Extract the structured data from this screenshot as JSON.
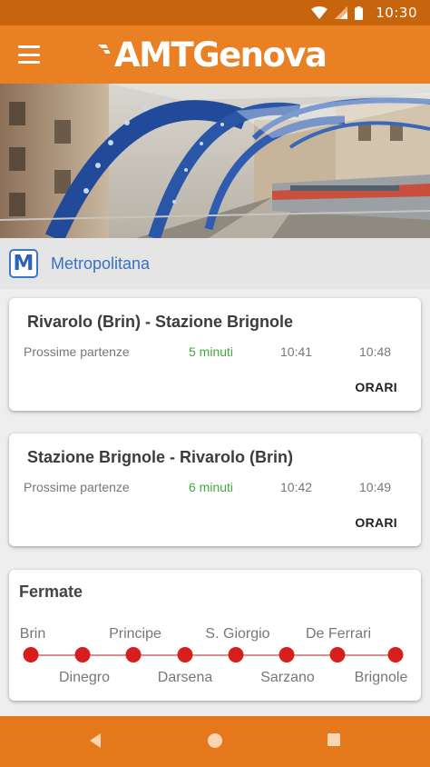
{
  "status_bar": {
    "time": "10:30",
    "icons": [
      "wifi-icon",
      "signal-icon",
      "battery-icon"
    ]
  },
  "app_bar": {
    "logo_text": "AMTGenova",
    "menu_icon": "menu-icon",
    "color": "#e98024"
  },
  "hero": {
    "description_icon": "metro-station-photo"
  },
  "section": {
    "icon_letter": "M",
    "title": "Metropolitana"
  },
  "routes": [
    {
      "title": "Rivarolo (Brin) - Stazione Brignole",
      "label": "Prossime partenze",
      "minutes": "5 minuti",
      "time1": "10:41",
      "time2": "10:48",
      "button": "ORARI"
    },
    {
      "title": "Stazione Brignole - Rivarolo (Brin)",
      "label": "Prossime partenze",
      "minutes": "6 minuti",
      "time1": "10:42",
      "time2": "10:49",
      "button": "ORARI"
    }
  ],
  "stops": {
    "title": "Fermate",
    "top_row": [
      "Brin",
      "Principe",
      "S. Giorgio",
      "De Ferrari"
    ],
    "bottom_row": [
      "Dinegro",
      "Darsena",
      "Sarzano",
      "Brignole"
    ],
    "dot_color": "#d61e1e"
  },
  "nav_bar": {
    "buttons": [
      "back-icon",
      "home-icon",
      "recents-icon"
    ]
  }
}
